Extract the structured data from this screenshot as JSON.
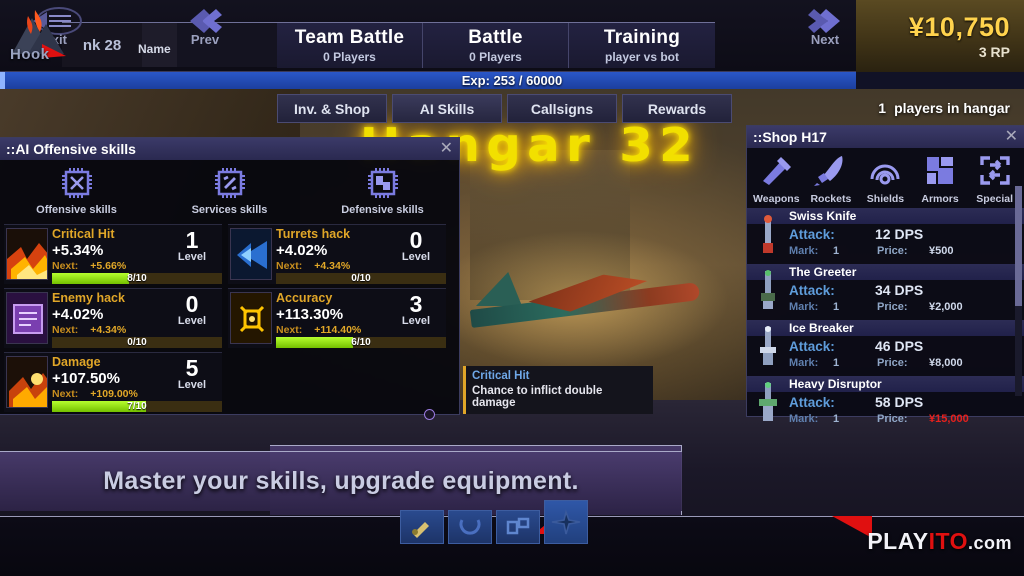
{
  "header": {
    "logo_text": "Hook",
    "rank": "nk 28",
    "name_label": "Name",
    "modes": [
      {
        "title": "Team Battle",
        "sub": "0 Players"
      },
      {
        "title": "Battle",
        "sub": "0 Players"
      },
      {
        "title": "Training",
        "sub": "player vs bot"
      }
    ],
    "money": "¥10,750",
    "rp": "3 RP",
    "exp_text": "Exp: 253 / 60000",
    "exp_current": 253,
    "exp_max": 60000
  },
  "subtabs": [
    {
      "label": "Inv. & Shop",
      "active": false
    },
    {
      "label": "AI Skills",
      "active": true
    },
    {
      "label": "Callsigns",
      "active": false
    },
    {
      "label": "Rewards",
      "active": false
    }
  ],
  "hangar": {
    "title": "Hangar 32",
    "players_count": "1",
    "players_label": "players in hangar"
  },
  "skills_panel": {
    "title": "::AI Offensive skills",
    "close": "✕",
    "categories": [
      {
        "label": "Offensive skills",
        "icon": "chip-offensive-icon"
      },
      {
        "label": "Services skills",
        "icon": "chip-services-icon"
      },
      {
        "label": "Defensive skills",
        "icon": "chip-defensive-icon"
      }
    ],
    "next_label": "Next:",
    "level_label": "Level",
    "skills": [
      {
        "name": "Critical Hit",
        "value": "+5.34%",
        "next": "+5.66%",
        "level": "1",
        "progress": "8/10",
        "pct": 45
      },
      {
        "name": "Turrets hack",
        "value": "+4.02%",
        "next": "+4.34%",
        "level": "0",
        "progress": "0/10",
        "pct": 0
      },
      {
        "name": "Enemy hack",
        "value": "+4.02%",
        "next": "+4.34%",
        "level": "0",
        "progress": "0/10",
        "pct": 0
      },
      {
        "name": "Accuracy",
        "value": "+113.30%",
        "next": "+114.40%",
        "level": "3",
        "progress": "6/10",
        "pct": 45
      },
      {
        "name": "Damage",
        "value": "+107.50%",
        "next": "+109.00%",
        "level": "5",
        "progress": "7/10",
        "pct": 55
      }
    ]
  },
  "tooltip": {
    "title": "Critical Hit",
    "body": "Chance to inflict double damage"
  },
  "shop_panel": {
    "title": "::Shop H17",
    "close": "✕",
    "categories": [
      {
        "label": "Weapons",
        "icon": "weapon-icon"
      },
      {
        "label": "Rockets",
        "icon": "rocket-icon"
      },
      {
        "label": "Shields",
        "icon": "shield-icon"
      },
      {
        "label": "Armors",
        "icon": "armor-icon"
      },
      {
        "label": "Special",
        "icon": "special-icon"
      }
    ],
    "attack_label": "Attack:",
    "mark_label": "Mark:",
    "price_label": "Price:",
    "items": [
      {
        "name": "Swiss Knife",
        "attack": "12 DPS",
        "mark": "1",
        "price": "¥500",
        "price_red": false
      },
      {
        "name": "The Greeter",
        "attack": "34 DPS",
        "mark": "1",
        "price": "¥2,000",
        "price_red": false
      },
      {
        "name": "Ice Breaker",
        "attack": "46 DPS",
        "mark": "1",
        "price": "¥8,000",
        "price_red": false
      },
      {
        "name": "Heavy Disruptor",
        "attack": "58 DPS",
        "mark": "1",
        "price": "¥15,000",
        "price_red": true
      }
    ]
  },
  "banner": {
    "text": "Master your skills, upgrade equipment."
  },
  "bottom": {
    "exit": "Exit",
    "prev": "Prev",
    "next": "Next",
    "brand_part1": "PLAY",
    "brand_part2": "ITO",
    "brand_part3": ".com"
  },
  "colors": {
    "accent_yellow": "#e0a628",
    "money": "#ffd34d",
    "neon": "#f2e000",
    "red": "#e01010",
    "blue": "#5f9ddb"
  }
}
